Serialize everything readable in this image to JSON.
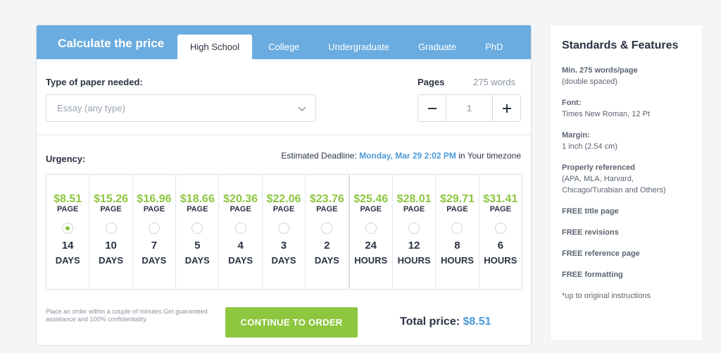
{
  "calculator": {
    "title": "Calculate the price",
    "tabs": [
      "High School",
      "College",
      "Undergraduate",
      "Graduate",
      "PhD"
    ],
    "active_tab": "High School",
    "paper_type_label": "Type of paper needed:",
    "paper_type_value": "Essay (any type)",
    "pages_label": "Pages",
    "words_label": "275 words",
    "pages_value": "1",
    "urgency_label": "Urgency:",
    "deadline_prefix": "Estimated Deadline:",
    "deadline_date": "Monday, Mar 29 2:02 PM",
    "deadline_suffix": "in Your timezone",
    "per_label": "PAGE",
    "urgency_options": [
      {
        "price": "$8.51",
        "num": "14",
        "unit": "DAYS",
        "selected": true
      },
      {
        "price": "$15.26",
        "num": "10",
        "unit": "DAYS",
        "selected": false
      },
      {
        "price": "$16.96",
        "num": "7",
        "unit": "DAYS",
        "selected": false
      },
      {
        "price": "$18.66",
        "num": "5",
        "unit": "DAYS",
        "selected": false
      },
      {
        "price": "$20.36",
        "num": "4",
        "unit": "DAYS",
        "selected": false
      },
      {
        "price": "$22.06",
        "num": "3",
        "unit": "DAYS",
        "selected": false
      },
      {
        "price": "$23.76",
        "num": "2",
        "unit": "DAYS",
        "selected": false
      },
      {
        "price": "$25.46",
        "num": "24",
        "unit": "HOURS",
        "selected": false
      },
      {
        "price": "$28.01",
        "num": "12",
        "unit": "HOURS",
        "selected": false
      },
      {
        "price": "$29.71",
        "num": "8",
        "unit": "HOURS",
        "selected": false
      },
      {
        "price": "$31.41",
        "num": "6",
        "unit": "HOURS",
        "selected": false
      }
    ],
    "note": "Place an order within a couple of minutes.Get guaranteed assistance and 100% confidentiality.",
    "cta_label": "CONTINUE TO ORDER",
    "total_label": "Total price:",
    "total_value": "$8.51"
  },
  "features": {
    "title": "Standards & Features",
    "items": [
      {
        "heading": "Min. 275 words/page",
        "detail": "(double spaced)"
      },
      {
        "heading": "Font:",
        "detail": "Times New Roman, 12 Pt"
      },
      {
        "heading": "Margin:",
        "detail": "1 inch (2.54 cm)"
      },
      {
        "heading": "Properly referenced",
        "detail": "(APA, MLA, Harvard, Chicago/Turabian and Others)"
      },
      {
        "heading": "FREE title page",
        "detail": ""
      },
      {
        "heading": "FREE revisions",
        "detail": ""
      },
      {
        "heading": "FREE reference page",
        "detail": ""
      },
      {
        "heading": "FREE formatting",
        "detail": ""
      },
      {
        "heading": "",
        "detail": "*up to original instructions"
      }
    ]
  },
  "colors": {
    "header": "#6aace0",
    "accent_green": "#8dc63f",
    "accent_blue": "#4c9ad8"
  }
}
